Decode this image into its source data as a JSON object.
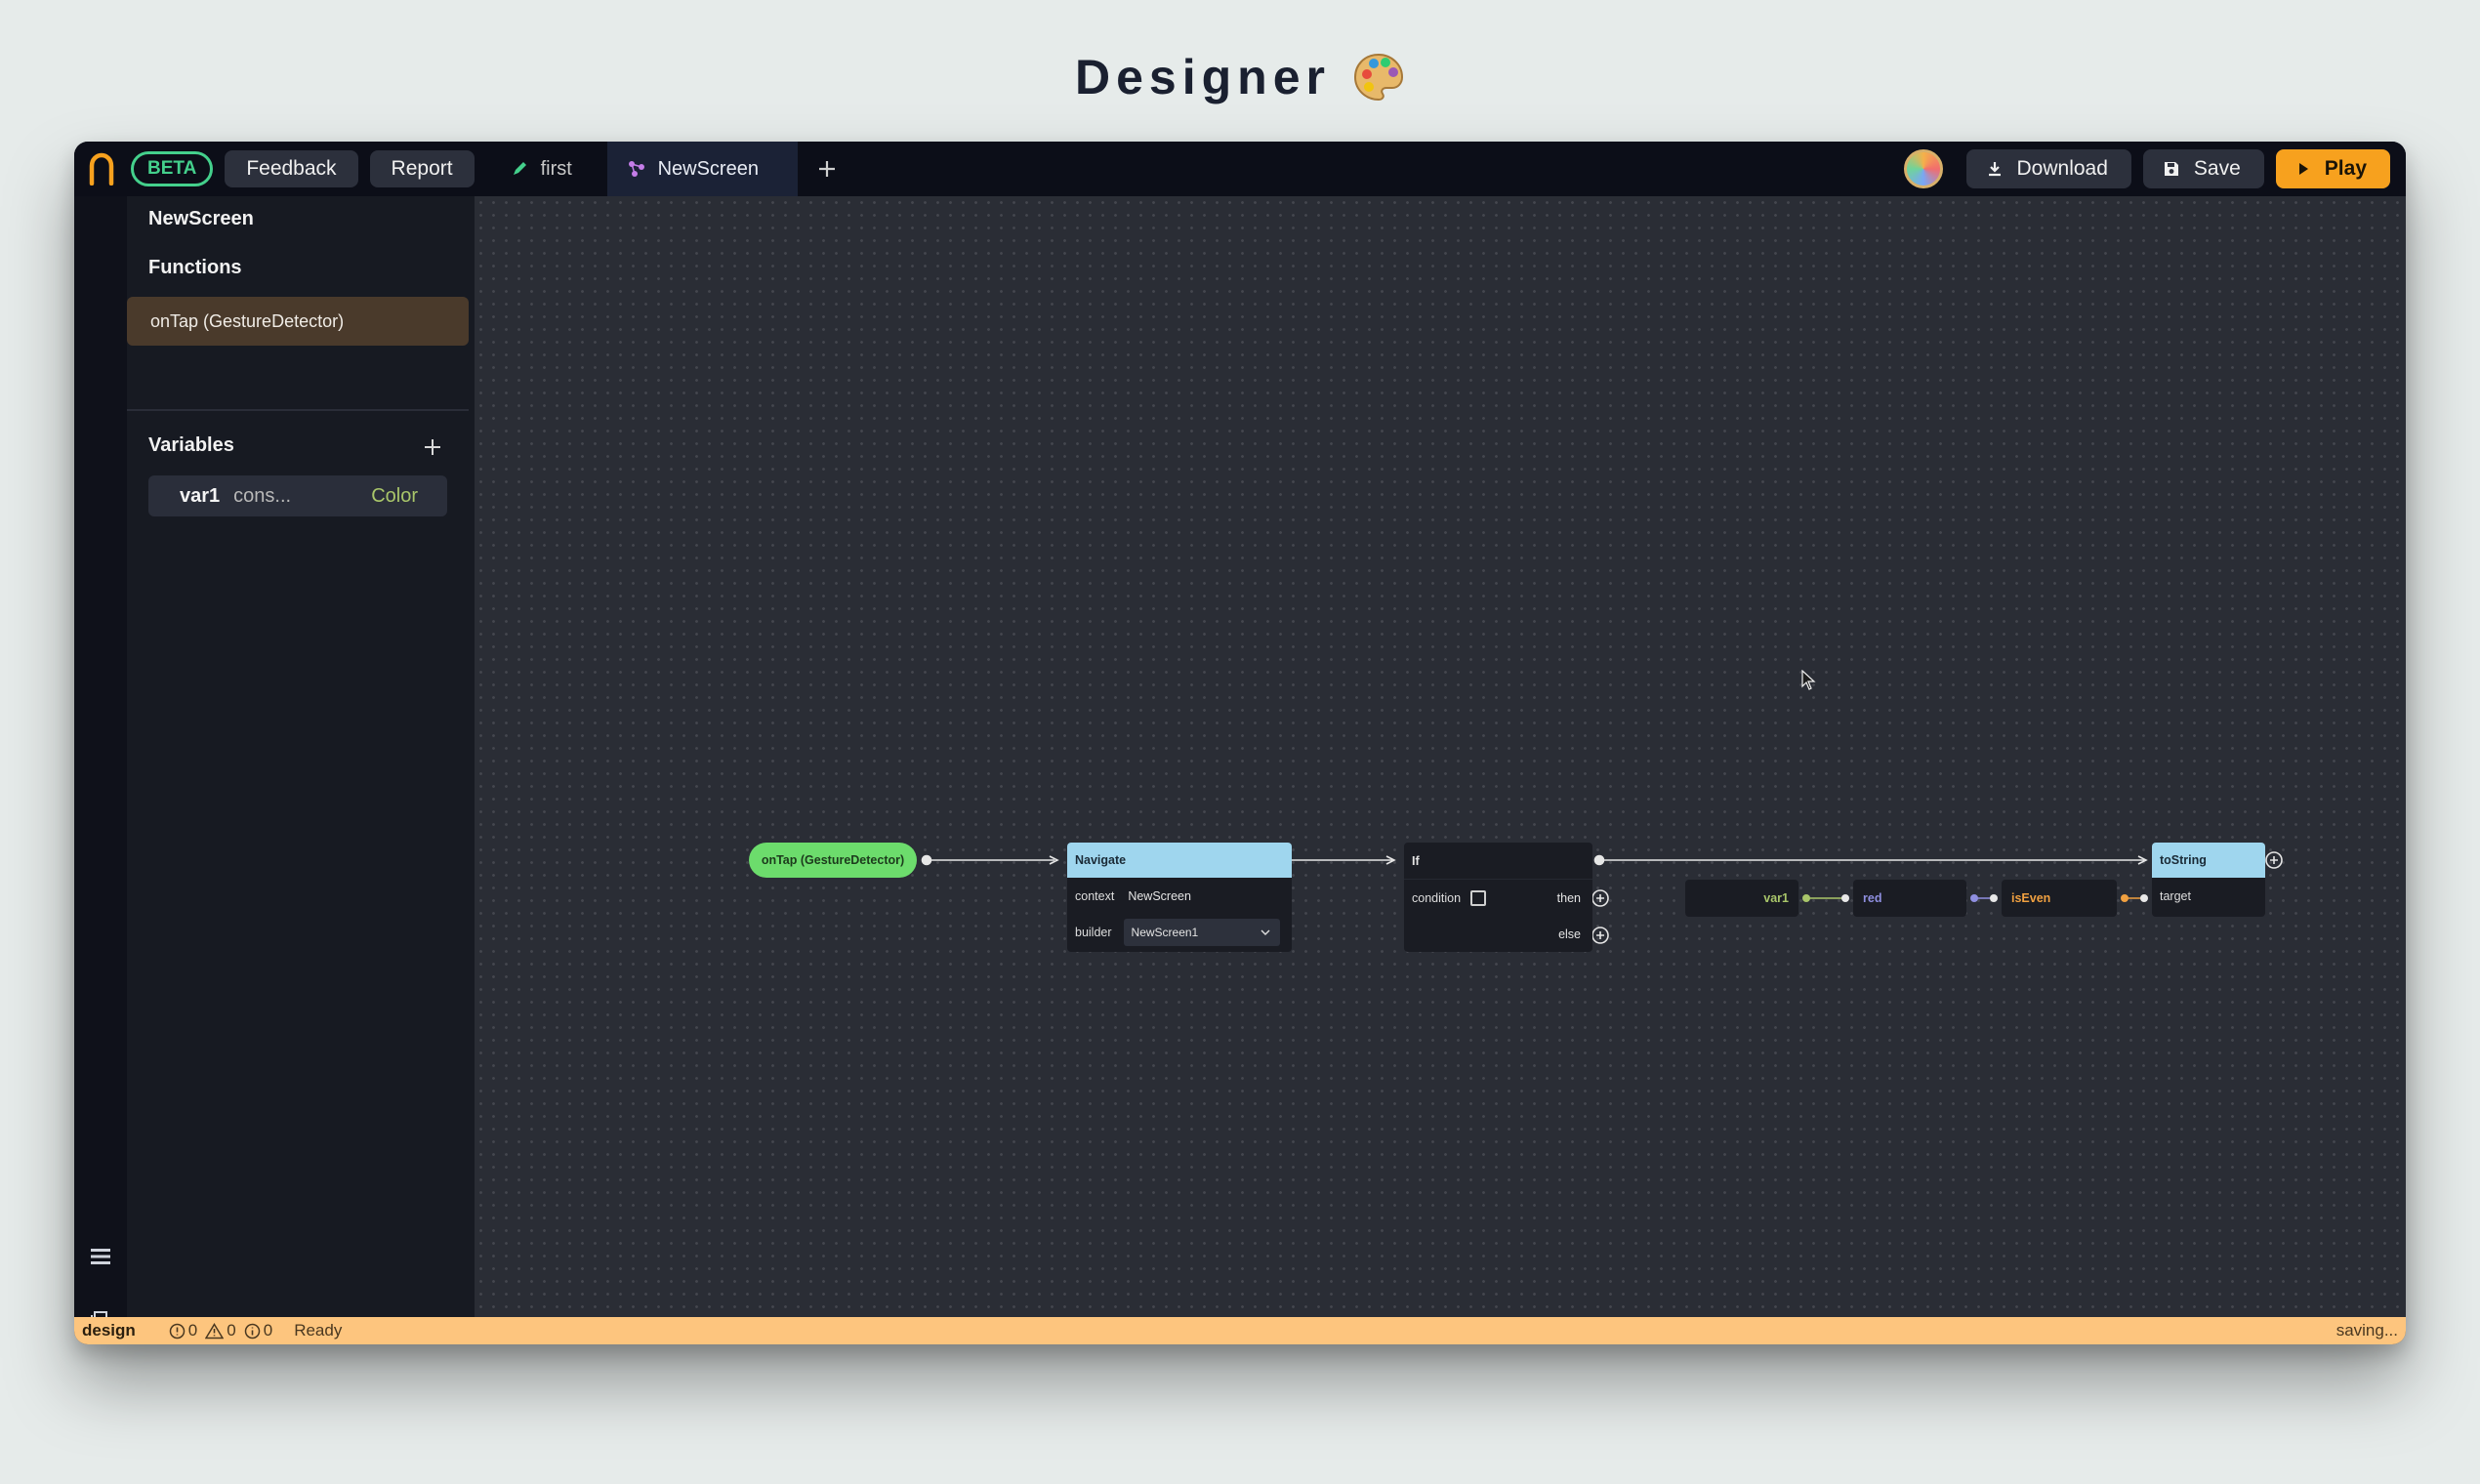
{
  "page": {
    "title": "Designer",
    "title_icon": "palette-icon"
  },
  "topbar": {
    "beta_label": "BETA",
    "feedback_label": "Feedback",
    "report_label": "Report",
    "tabs": [
      {
        "label": "first",
        "icon": "pencil-icon",
        "active": false
      },
      {
        "label": "NewScreen",
        "icon": "graph-icon",
        "active": true
      }
    ],
    "download_label": "Download",
    "save_label": "Save",
    "play_label": "Play",
    "accent_color": "#f7a11e"
  },
  "sidebar": {
    "screen_title": "NewScreen",
    "functions_heading": "Functions",
    "functions": [
      {
        "label": "onTap (GestureDetector)",
        "selected": true
      }
    ],
    "variables_heading": "Variables",
    "variables": [
      {
        "name": "var1",
        "value": "cons...",
        "type": "Color"
      }
    ]
  },
  "canvas": {
    "trigger": {
      "label": "onTap (GestureDetector)",
      "color": "#6cdc6c"
    },
    "navigate": {
      "title": "Navigate",
      "context_label": "context",
      "context_value": "NewScreen",
      "builder_label": "builder",
      "builder_value": "NewScreen1"
    },
    "if_node": {
      "title": "If",
      "condition_label": "condition",
      "then_label": "then",
      "else_label": "else"
    },
    "chain": {
      "var_label": "var1",
      "red_label": "red",
      "is_even_label": "isEven"
    },
    "to_string": {
      "title": "toString",
      "target_label": "target"
    }
  },
  "statusbar": {
    "mode": "design",
    "errors": "0",
    "warnings": "0",
    "infos": "0",
    "status": "Ready",
    "saving": "saving..."
  }
}
